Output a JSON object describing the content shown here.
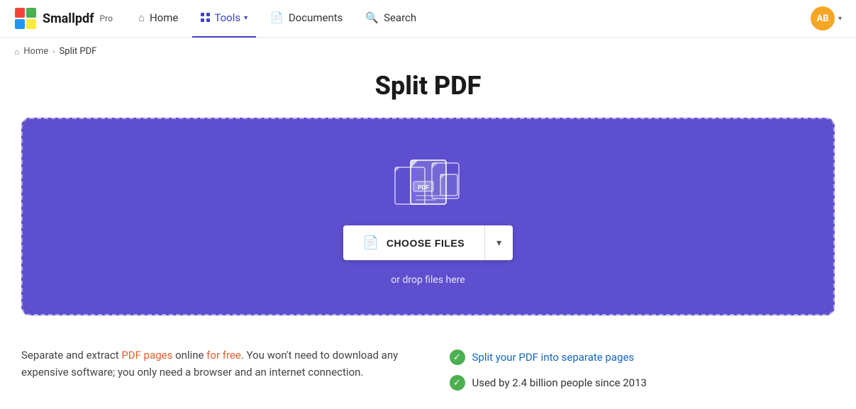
{
  "brand": {
    "name": "Smallpdf",
    "pro_label": "Pro"
  },
  "nav": {
    "home_label": "Home",
    "tools_label": "Tools",
    "documents_label": "Documents",
    "search_label": "Search"
  },
  "breadcrumb": {
    "home": "Home",
    "separator": "›",
    "current": "Split PDF"
  },
  "page": {
    "title": "Split PDF"
  },
  "dropzone": {
    "choose_files_label": "CHOOSE FILES",
    "drop_hint": "or drop files here"
  },
  "description": {
    "left": "Separate and extract PDF pages online for free. You won't need to download any expensive software; you only need a browser and an internet connection.",
    "features": [
      {
        "id": "f1",
        "text": "Split your PDF into separate pages"
      },
      {
        "id": "f2",
        "text": "Used by 2.4 billion people since 2013"
      }
    ]
  },
  "avatar": {
    "initials": "AB"
  }
}
